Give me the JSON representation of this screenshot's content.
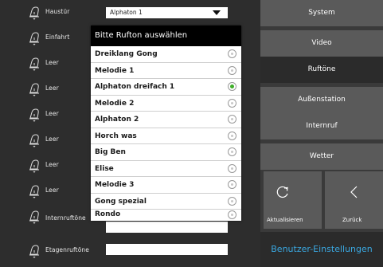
{
  "rows": [
    {
      "label": "Haustür",
      "value": "Alphaton 1"
    },
    {
      "label": "Einfahrt",
      "value": ""
    },
    {
      "label": "Leer",
      "value": ""
    },
    {
      "label": "Leer",
      "value": ""
    },
    {
      "label": "Leer",
      "value": ""
    },
    {
      "label": "Leer",
      "value": ""
    },
    {
      "label": "Leer",
      "value": ""
    },
    {
      "label": "Leer",
      "value": ""
    },
    {
      "label": "Internruftöne",
      "value": ""
    },
    {
      "label": "Etagenruftöne",
      "value": ""
    }
  ],
  "dropdown": {
    "header": "Bitte Rufton auswählen",
    "options": [
      {
        "label": "Dreiklang Gong",
        "selected": false
      },
      {
        "label": "Melodie 1",
        "selected": false
      },
      {
        "label": "Alphaton dreifach 1",
        "selected": true
      },
      {
        "label": "Melodie 2",
        "selected": false
      },
      {
        "label": "Alphaton 2",
        "selected": false
      },
      {
        "label": "Horch was",
        "selected": false
      },
      {
        "label": "Big Ben",
        "selected": false
      },
      {
        "label": "Elise",
        "selected": false
      },
      {
        "label": "Melodie 3",
        "selected": false
      },
      {
        "label": "Gong spezial",
        "selected": false
      },
      {
        "label": "Rondo",
        "selected": false
      }
    ]
  },
  "nav": {
    "system": "System",
    "video": "Video",
    "ruftoene": "Ruftöne",
    "aussenstation": "Außenstation",
    "internruf": "Internruf",
    "wetter": "Wetter",
    "aktualisieren": "Aktualisieren",
    "zurueck": "Zurück",
    "benutzer": "Benutzer-Einstellungen"
  },
  "colors": {
    "accent": "#3aa7e0",
    "selected_radio": "#3fae2a"
  }
}
